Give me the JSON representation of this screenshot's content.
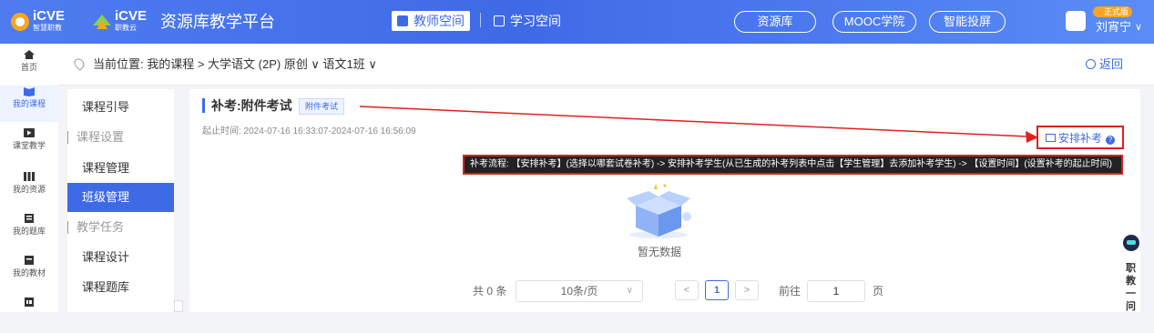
{
  "header": {
    "logo1_text": "iCVE",
    "logo1_sub": "智慧职教",
    "logo2_text": "iCVE",
    "logo2_sub": "职教云",
    "app_title": "资源库教学平台",
    "nav_teacher": "教师空间",
    "nav_student": "学习空间",
    "pills": [
      "资源库",
      "MOOC学院",
      "智能投屏"
    ],
    "user_badge": "正式版",
    "user_name": "刘宵宁",
    "user_caret": "∨"
  },
  "leftbar": {
    "items": [
      {
        "label": "首页",
        "icon": "home-icon"
      },
      {
        "label": "我的课程",
        "icon": "book-icon"
      },
      {
        "label": "课堂教学",
        "icon": "play-icon"
      },
      {
        "label": "我的资源",
        "icon": "library-icon"
      },
      {
        "label": "我的题库",
        "icon": "question-bank-icon"
      },
      {
        "label": "我的教材",
        "icon": "textbook-icon"
      },
      {
        "label": "",
        "icon": "more-icon"
      }
    ]
  },
  "breadcrumb": {
    "text": "当前位置: 我的课程 > 大学语文 (2P) 原创 ∨ 语文1班 ∨",
    "back": "返回"
  },
  "sidebar": {
    "items": [
      {
        "label": "课程引导",
        "type": "item"
      },
      {
        "label": "课程设置",
        "type": "group"
      },
      {
        "label": "课程管理",
        "type": "item"
      },
      {
        "label": "班级管理",
        "type": "item",
        "active": true
      },
      {
        "label": "教学任务",
        "type": "group"
      },
      {
        "label": "课程设计",
        "type": "item"
      },
      {
        "label": "课程题库",
        "type": "item"
      }
    ]
  },
  "main": {
    "title": "补考:附件考试",
    "tag": "附件考试",
    "time": "起止时间: 2024-07-16 16:33:07-2024-07-16 16:56:09",
    "arrange_label": "安排补考",
    "help_icon": "?",
    "hint": "补考流程: 【安排补考】(选择以哪套试卷补考) -> 安排补考学生(从已生成的补考列表中点击【学生管理】去添加补考学生) -> 【设置时间】(设置补考的起止时间)",
    "empty_text": "暂无数据"
  },
  "pager": {
    "total": "共 0 条",
    "page_size": "10条/页",
    "prev": "<",
    "current": "1",
    "next": ">",
    "goto_label": "前往",
    "goto_value": "1",
    "page_suffix": "页"
  },
  "helper": {
    "text": "职教一问"
  },
  "colors": {
    "accent": "#3f6ae6",
    "highlight_border": "#e02020"
  }
}
